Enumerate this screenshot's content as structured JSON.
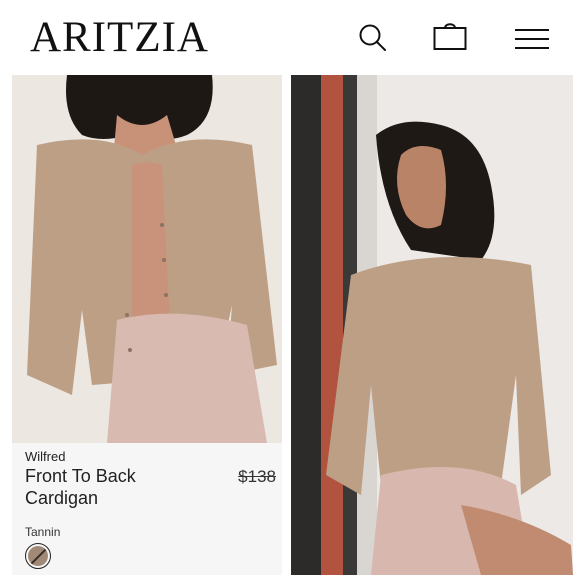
{
  "header": {
    "logo": "ARITZIA",
    "icons": [
      "search-icon",
      "shopping-bag-icon",
      "hamburger-menu-icon"
    ]
  },
  "product": {
    "brand": "Wilfred",
    "name": "Front To Back Cardigan",
    "price": "$138",
    "color_label": "Tannin",
    "swatch_color": "#a08a77"
  },
  "colors": {
    "text": "#111111",
    "card_bg": "#f6f6f6",
    "sweater": "#bd9f86",
    "skirt": "#d8b8ae"
  }
}
